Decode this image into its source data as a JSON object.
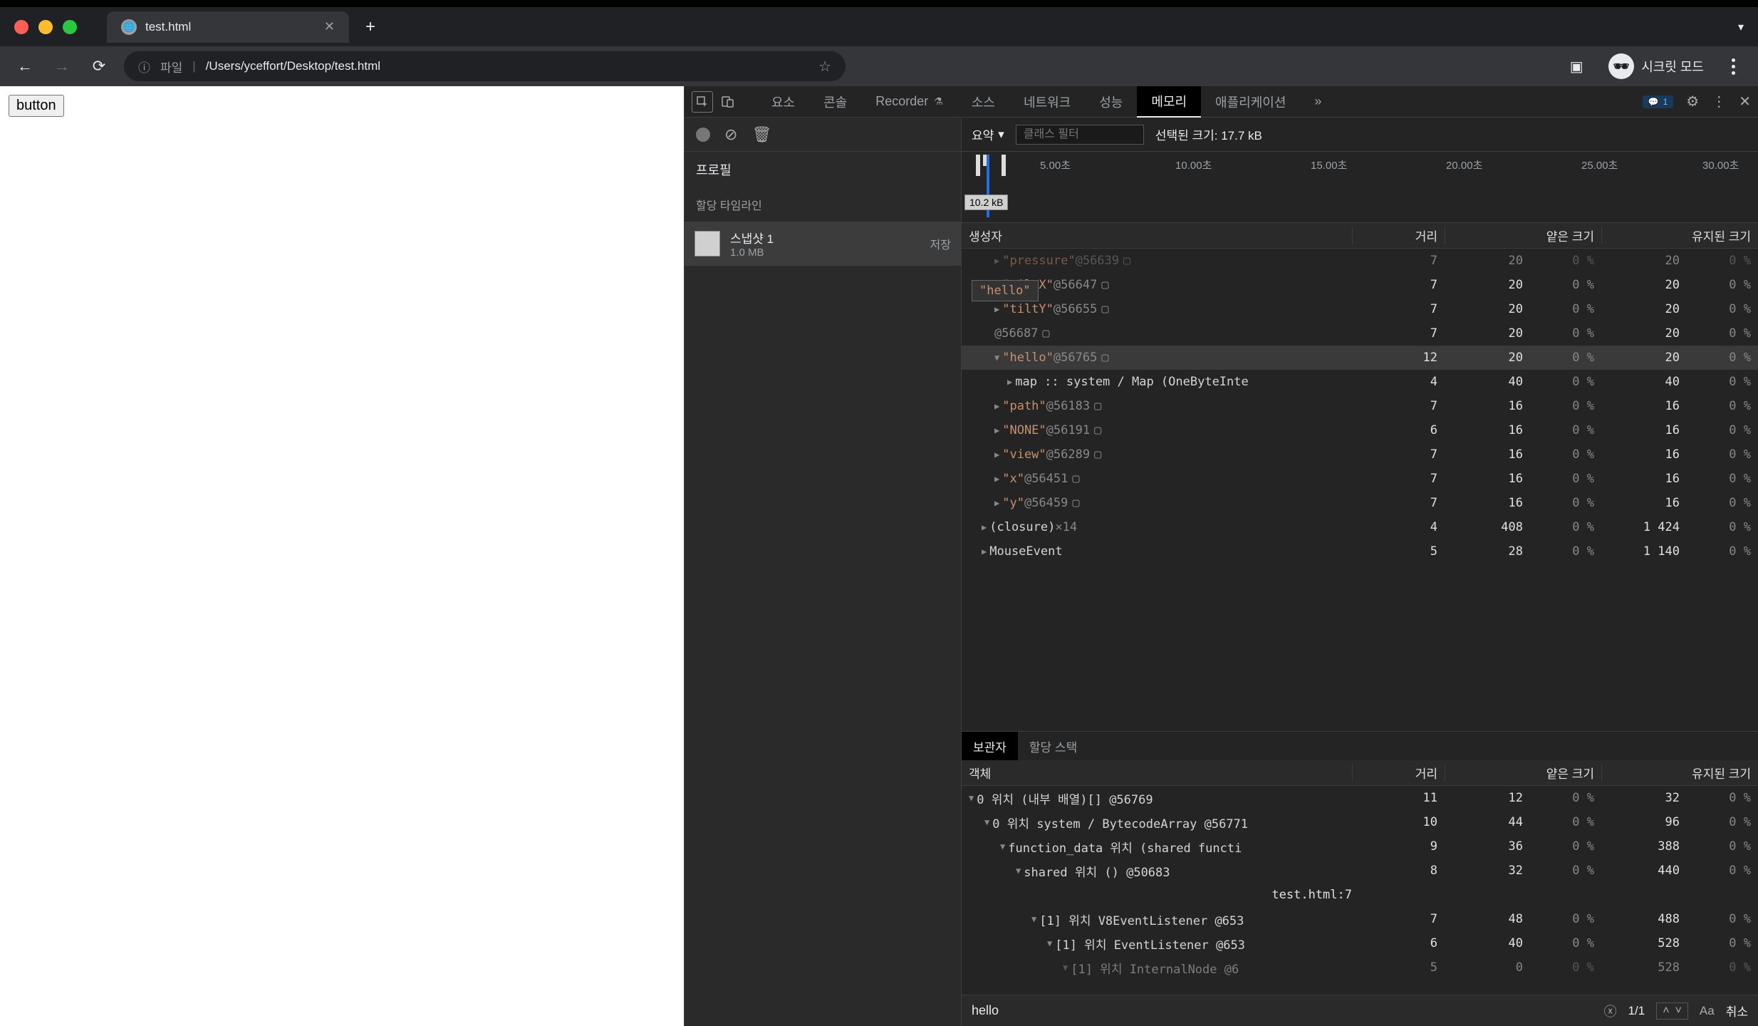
{
  "tab": {
    "title": "test.html"
  },
  "url": {
    "info_label": "파일",
    "path": "/Users/yceffort/Desktop/test.html"
  },
  "incognito_label": "시크릿 모드",
  "page_button": "button",
  "devtools_tabs": {
    "elements": "요소",
    "console": "콘솔",
    "recorder": "Recorder",
    "sources": "소스",
    "network": "네트워크",
    "performance": "성능",
    "memory": "메모리",
    "application": "애플리케이션"
  },
  "message_count": "1",
  "left_panel": {
    "profiles_label": "프로필",
    "timeline_label": "할당 타임라인",
    "snapshot": {
      "title": "스냅샷 1",
      "size": "1.0 MB",
      "save": "저장"
    }
  },
  "toolbar": {
    "summary": "요약",
    "filter_placeholder": "클래스 필터",
    "selected_size": "선택된 크기: 17.7 kB"
  },
  "timeline": {
    "ticks": [
      "5.00초",
      "10.00초",
      "15.00초",
      "20.00초",
      "25.00초",
      "30.00초"
    ],
    "size_tag": "10.2 kB"
  },
  "headers": {
    "constructor": "생성자",
    "distance": "거리",
    "shallow": "얕은 크기",
    "retained": "유지된 크기"
  },
  "rows": [
    {
      "indent": 2,
      "arrow": "▶",
      "name": "\"pressure\"",
      "ns": "str",
      "id": "@56639",
      "box": true,
      "d": "7",
      "s": "20",
      "sp": "0 %",
      "r": "20",
      "rp": "0 %",
      "cut": true
    },
    {
      "indent": 2,
      "arrow": "▶",
      "name": "\"tiltX\"",
      "ns": "str",
      "id": "@56647",
      "box": true,
      "d": "7",
      "s": "20",
      "sp": "0 %",
      "r": "20",
      "rp": "0 %"
    },
    {
      "indent": 2,
      "arrow": "▶",
      "name": "\"tiltY\"",
      "ns": "str",
      "id": "@56655",
      "box": true,
      "d": "7",
      "s": "20",
      "sp": "0 %",
      "r": "20",
      "rp": "0 %"
    },
    {
      "indent": 2,
      "arrow": "",
      "name": "",
      "ns": "str",
      "id": "@56687",
      "box": true,
      "d": "7",
      "s": "20",
      "sp": "0 %",
      "r": "20",
      "rp": "0 %"
    },
    {
      "indent": 2,
      "arrow": "▼",
      "name": "\"hello\"",
      "ns": "str",
      "id": "@56765",
      "box": true,
      "d": "12",
      "s": "20",
      "sp": "0 %",
      "r": "20",
      "rp": "0 %",
      "sel": true
    },
    {
      "indent": 3,
      "arrow": "▶",
      "name": "map :: system / Map (OneByteInte",
      "ns": "prop",
      "id": "",
      "box": false,
      "d": "4",
      "s": "40",
      "sp": "0 %",
      "r": "40",
      "rp": "0 %"
    },
    {
      "indent": 2,
      "arrow": "▶",
      "name": "\"path\"",
      "ns": "str",
      "id": "@56183",
      "box": true,
      "d": "7",
      "s": "16",
      "sp": "0 %",
      "r": "16",
      "rp": "0 %"
    },
    {
      "indent": 2,
      "arrow": "▶",
      "name": "\"NONE\"",
      "ns": "str",
      "id": "@56191",
      "box": true,
      "d": "6",
      "s": "16",
      "sp": "0 %",
      "r": "16",
      "rp": "0 %"
    },
    {
      "indent": 2,
      "arrow": "▶",
      "name": "\"view\"",
      "ns": "str",
      "id": "@56289",
      "box": true,
      "d": "7",
      "s": "16",
      "sp": "0 %",
      "r": "16",
      "rp": "0 %"
    },
    {
      "indent": 2,
      "arrow": "▶",
      "name": "\"x\"",
      "ns": "str",
      "id": "@56451",
      "box": true,
      "d": "7",
      "s": "16",
      "sp": "0 %",
      "r": "16",
      "rp": "0 %"
    },
    {
      "indent": 2,
      "arrow": "▶",
      "name": "\"y\"",
      "ns": "str",
      "id": "@56459",
      "box": true,
      "d": "7",
      "s": "16",
      "sp": "0 %",
      "r": "16",
      "rp": "0 %"
    },
    {
      "indent": 1,
      "arrow": "▶",
      "name": "(closure)",
      "ns": "prop",
      "id": "×14",
      "box": false,
      "d": "4",
      "s": "408",
      "sp": "0 %",
      "r": "1 424",
      "rp": "0 %"
    },
    {
      "indent": 1,
      "arrow": "▶",
      "name": "MouseEvent",
      "ns": "prop",
      "id": "",
      "box": false,
      "d": "5",
      "s": "28",
      "sp": "0 %",
      "r": "1 140",
      "rp": "0 %"
    }
  ],
  "tooltip": "\"hello\"",
  "retainers_tabs": {
    "retainers": "보관자",
    "stack": "할당 스택"
  },
  "obj_header": "객체",
  "ret_rows": [
    {
      "indent": 0,
      "arrow": "▼",
      "text": "0 위치 (내부 배열)[] @56769",
      "d": "11",
      "s": "12",
      "sp": "0 %",
      "r": "32",
      "rp": "0 %"
    },
    {
      "indent": 1,
      "arrow": "▼",
      "text": "0 위치 system / BytecodeArray @56771",
      "d": "10",
      "s": "44",
      "sp": "0 %",
      "r": "96",
      "rp": "0 %"
    },
    {
      "indent": 2,
      "arrow": "▼",
      "text": "function_data 위치 (shared functi",
      "d": "9",
      "s": "36",
      "sp": "0 %",
      "r": "388",
      "rp": "0 %"
    },
    {
      "indent": 3,
      "arrow": "▼",
      "text": "shared 위치 () @50683",
      "d": "8",
      "s": "32",
      "sp": "0 %",
      "r": "440",
      "rp": "0 %"
    },
    {
      "indent": 4,
      "arrow": "",
      "text": "",
      "link": "test.html:7",
      "d": "",
      "s": "",
      "sp": "",
      "r": "",
      "rp": ""
    },
    {
      "indent": 4,
      "arrow": "▼",
      "text": "[1] 위치 V8EventListener @653",
      "d": "7",
      "s": "48",
      "sp": "0 %",
      "r": "488",
      "rp": "0 %"
    },
    {
      "indent": 5,
      "arrow": "▼",
      "text": "[1] 위치 EventListener @653",
      "d": "6",
      "s": "40",
      "sp": "0 %",
      "r": "528",
      "rp": "0 %"
    },
    {
      "indent": 6,
      "arrow": "▼",
      "text": "[1] 위치 InternalNode @6",
      "d": "5",
      "s": "0",
      "sp": "0 %",
      "r": "528",
      "rp": "0 %",
      "cut": true
    }
  ],
  "search": {
    "value": "hello",
    "count": "1/1",
    "aa": "Aa",
    "cancel": "취소"
  }
}
